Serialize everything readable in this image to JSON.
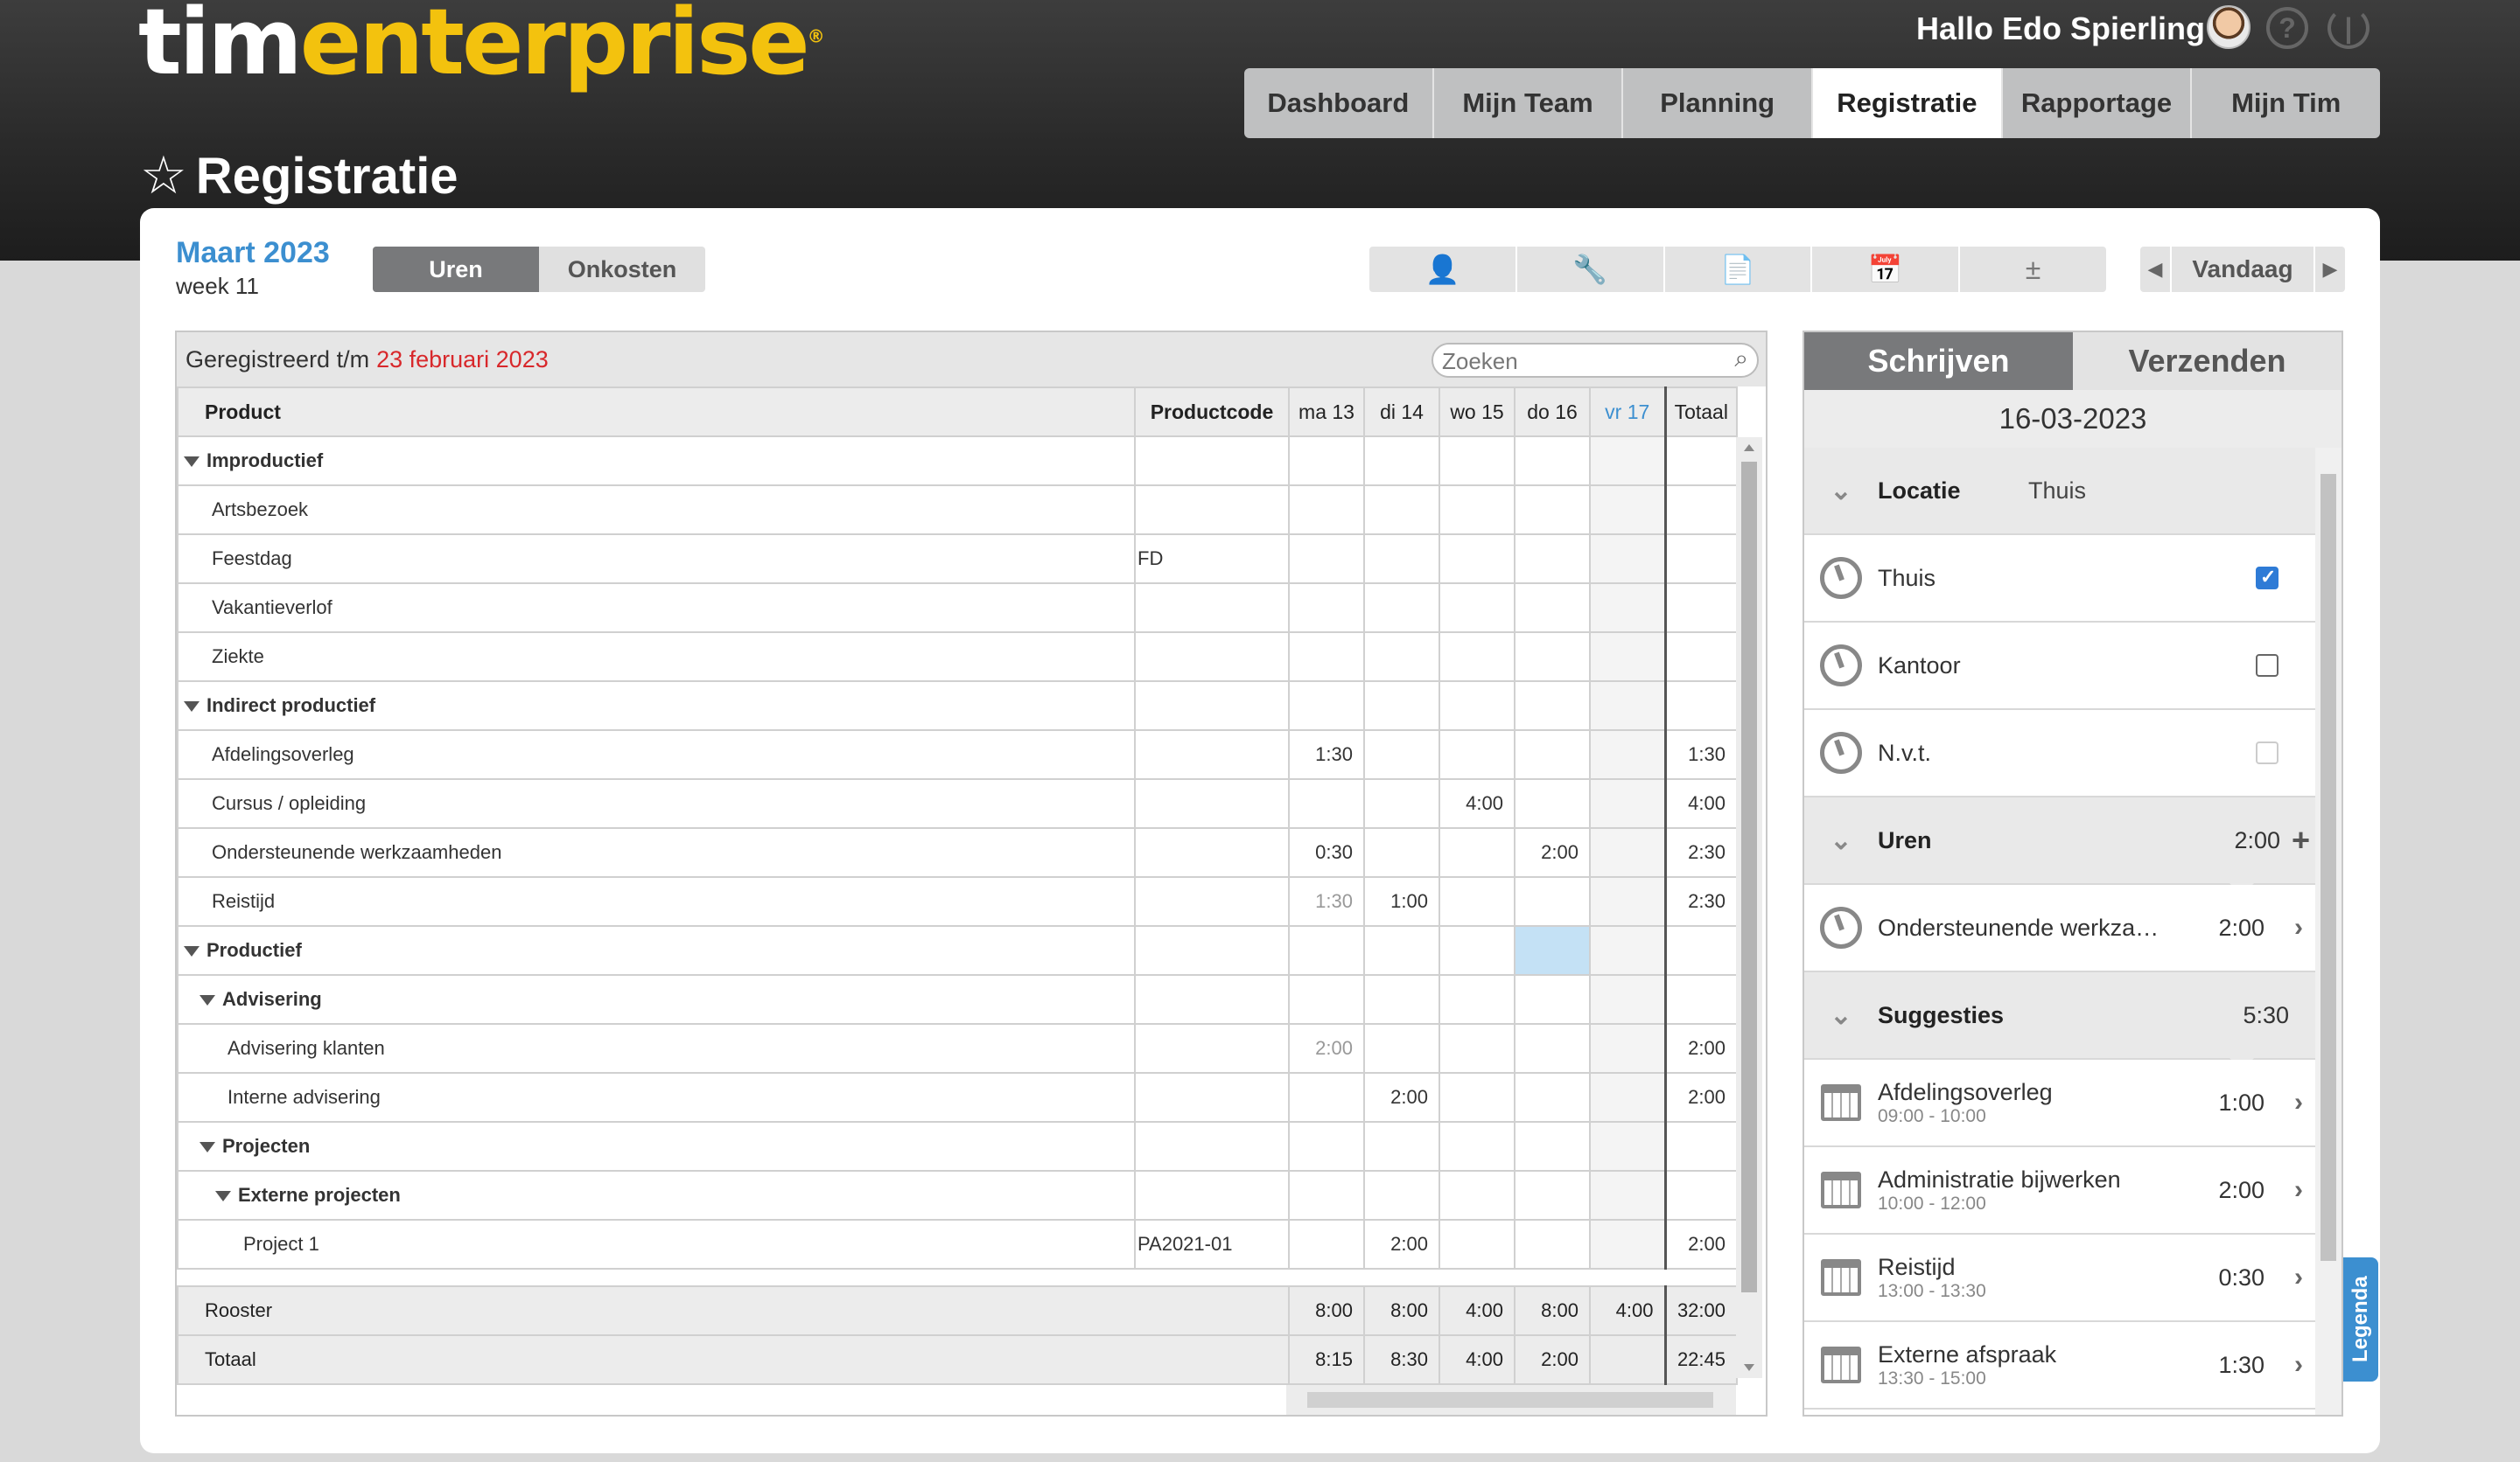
{
  "app": {
    "logo_part1": "tim",
    "logo_part2": "enterprise",
    "logo_mark": "®",
    "greeting": "Hallo Edo Spierling",
    "icons": [
      "avatar",
      "help-icon",
      "power-icon"
    ]
  },
  "nav": {
    "tabs": [
      "Dashboard",
      "Mijn Team",
      "Planning",
      "Registratie",
      "Rapportage",
      "Mijn Tim"
    ],
    "active": "Registratie"
  },
  "page": {
    "title": "Registratie",
    "month": "Maart 2023",
    "week": "week 11",
    "segment": [
      "Uren",
      "Onkosten"
    ],
    "segment_active": "Uren",
    "toolbar_icons": [
      "person-icon",
      "wrench-icon",
      "document-icon",
      "calendar-icon",
      "plus-minus-icon"
    ],
    "today_label": "Vandaag"
  },
  "grid": {
    "registered_label": "Geregistreerd t/m",
    "registered_date": "23 februari 2023",
    "search_placeholder": "Zoeken",
    "headers": {
      "product": "Product",
      "productcode": "Productcode",
      "days": [
        "ma 13",
        "di 14",
        "wo 15",
        "do 16",
        "vr 17"
      ],
      "total": "Totaal"
    },
    "rows": [
      {
        "label": "Improductief",
        "code": "",
        "ma": "",
        "di": "",
        "wo": "",
        "do": "",
        "vr": "",
        "tot": ""
      },
      {
        "label": "Artsbezoek",
        "code": "",
        "ma": "",
        "di": "",
        "wo": "",
        "do": "",
        "vr": "",
        "tot": ""
      },
      {
        "label": "Feestdag",
        "code": "FD",
        "ma": "",
        "di": "",
        "wo": "",
        "do": "",
        "vr": "",
        "tot": ""
      },
      {
        "label": "Vakantieverlof",
        "code": "",
        "ma": "",
        "di": "",
        "wo": "",
        "do": "",
        "vr": "",
        "tot": ""
      },
      {
        "label": "Ziekte",
        "code": "",
        "ma": "",
        "di": "",
        "wo": "",
        "do": "",
        "vr": "",
        "tot": ""
      },
      {
        "label": "Indirect productief",
        "code": "",
        "ma": "",
        "di": "",
        "wo": "",
        "do": "",
        "vr": "",
        "tot": ""
      },
      {
        "label": "Afdelingsoverleg",
        "code": "",
        "ma": "1:30",
        "di": "",
        "wo": "",
        "do": "",
        "vr": "",
        "tot": "1:30"
      },
      {
        "label": "Cursus / opleiding",
        "code": "",
        "ma": "",
        "di": "",
        "wo": "4:00",
        "do": "",
        "vr": "",
        "tot": "4:00"
      },
      {
        "label": "Ondersteunende werkzaamheden",
        "code": "",
        "ma": "0:30",
        "di": "",
        "wo": "",
        "do": "2:00",
        "vr": "",
        "tot": "2:30"
      },
      {
        "label": "Reistijd",
        "code": "",
        "ma": "1:30",
        "di": "1:00",
        "wo": "",
        "do": "",
        "vr": "",
        "tot": "2:30"
      },
      {
        "label": "Productief",
        "code": "",
        "ma": "",
        "di": "",
        "wo": "",
        "do": "",
        "vr": "",
        "tot": ""
      },
      {
        "label": "Advisering",
        "code": "",
        "ma": "",
        "di": "",
        "wo": "",
        "do": "",
        "vr": "",
        "tot": ""
      },
      {
        "label": "Advisering klanten",
        "code": "",
        "ma": "2:00",
        "di": "",
        "wo": "",
        "do": "",
        "vr": "",
        "tot": "2:00"
      },
      {
        "label": "Interne advisering",
        "code": "",
        "ma": "",
        "di": "2:00",
        "wo": "",
        "do": "",
        "vr": "",
        "tot": "2:00"
      },
      {
        "label": "Projecten",
        "code": "",
        "ma": "",
        "di": "",
        "wo": "",
        "do": "",
        "vr": "",
        "tot": ""
      },
      {
        "label": "Externe projecten",
        "code": "",
        "ma": "",
        "di": "",
        "wo": "",
        "do": "",
        "vr": "",
        "tot": ""
      },
      {
        "label": "Project 1",
        "code": "PA2021-01",
        "ma": "",
        "di": "2:00",
        "wo": "",
        "do": "",
        "vr": "",
        "tot": "2:00"
      }
    ],
    "footer": [
      {
        "label": "Rooster",
        "ma": "8:00",
        "di": "8:00",
        "wo": "4:00",
        "do": "8:00",
        "vr": "4:00",
        "tot": "32:00"
      },
      {
        "label": "Totaal",
        "ma": "8:15",
        "di": "8:30",
        "wo": "4:00",
        "do": "2:00",
        "vr": "",
        "tot": "22:45"
      }
    ]
  },
  "side": {
    "tabs": [
      "Schrijven",
      "Verzenden"
    ],
    "date": "16-03-2023",
    "locatie": {
      "title": "Locatie",
      "value": "Thuis"
    },
    "locations": [
      {
        "label": "Thuis",
        "checked": true
      },
      {
        "label": "Kantoor",
        "checked": false
      },
      {
        "label": "N.v.t.",
        "checked": false
      }
    ],
    "uren": {
      "title": "Uren",
      "value": "2:00",
      "plus": "+"
    },
    "uren_items": [
      {
        "label": "Ondersteunende werkza…",
        "value": "2:00"
      }
    ],
    "suggesties": {
      "title": "Suggesties",
      "value": "5:30"
    },
    "suggestions": [
      {
        "label": "Afdelingsoverleg",
        "time": "09:00 - 10:00",
        "value": "1:00"
      },
      {
        "label": "Administratie bijwerken",
        "time": "10:00 - 12:00",
        "value": "2:00"
      },
      {
        "label": "Reistijd",
        "time": "13:00 - 13:30",
        "value": "0:30"
      },
      {
        "label": "Externe afspraak",
        "time": "13:30 - 15:00",
        "value": "1:30"
      }
    ],
    "legenda": "Legenda"
  }
}
